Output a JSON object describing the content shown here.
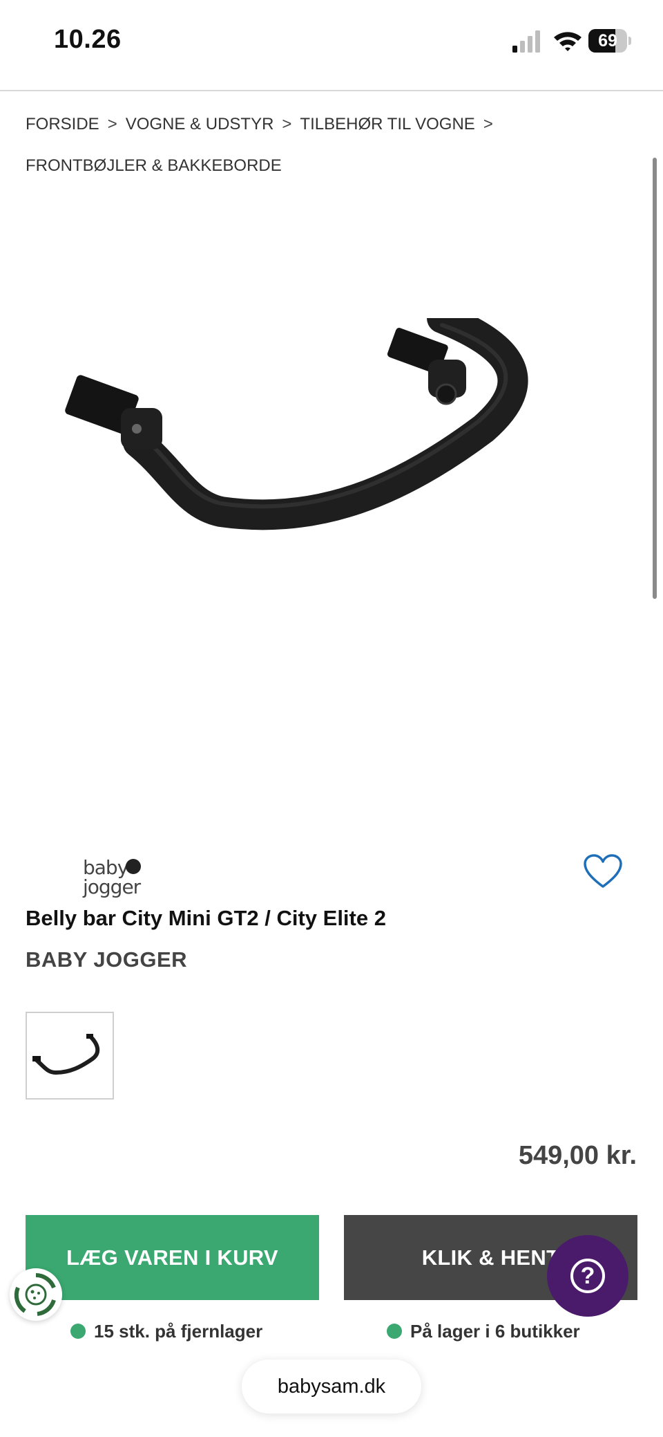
{
  "status_bar": {
    "time": "10.26",
    "battery_level": "69",
    "battery_fraction": 0.69
  },
  "breadcrumb": {
    "items": [
      "FORSIDE",
      "VOGNE & UDSTYR",
      "TILBEHØR TIL VOGNE",
      "FRONTBØJLER & BAKKEBORDE"
    ],
    "separator": ">"
  },
  "product": {
    "brand_logo_line1": "baby",
    "brand_logo_line2": "jogger",
    "title": "Belly bar City Mini GT2 / City Elite 2",
    "brand": "BABY JOGGER",
    "price": "549,00 kr."
  },
  "actions": {
    "add_to_cart": "LÆG VAREN I KURV",
    "click_collect": "KLIK & HENT",
    "help": "?"
  },
  "stock": {
    "warehouse": "15 stk. på fjernlager",
    "stores": "På lager i 6 butikker"
  },
  "browser": {
    "url": "babysam.dk"
  },
  "colors": {
    "primary_green": "#3aa870",
    "dark_button": "#464646",
    "help_purple": "#4a1b6b",
    "wishlist_blue": "#1f6fb8"
  },
  "icons": {
    "wishlist": "heart-outline-icon",
    "help": "question-circle-icon",
    "cookie": "cookie-recycle-icon"
  }
}
